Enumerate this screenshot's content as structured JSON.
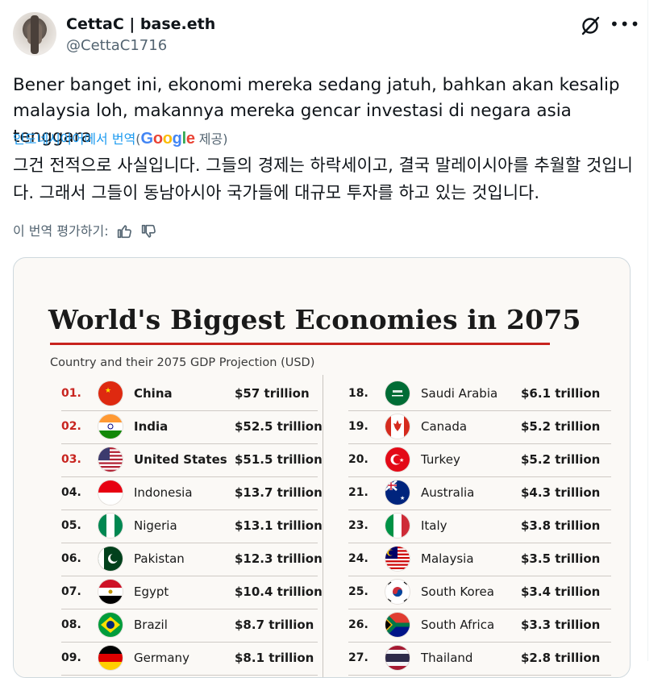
{
  "user": {
    "display_name": "CettaC | base.eth",
    "handle": "@CettaC1716"
  },
  "tweet": {
    "text": "Bener banget ini, ekonomi mereka sedang jatuh, bahkan akan kesalip malaysia loh, makannya mereka gencar investasi di negara asia tenggara",
    "translate_link": "인도네시아어에서 번역",
    "translate_prefix": "(",
    "translate_provider": "Google",
    "translate_suffix": " 제공)",
    "translated_text": "그건 전적으로 사실입니다. 그들의 경제는 하락세이고, 결국 말레이시아를 추월할 것입니다. 그래서 그들이 동남아시아 국가들에 대규모 투자를 하고 있는 것입니다.",
    "rate_label": "이 번역 평가하기:"
  },
  "icons": {
    "grok": "grok-icon",
    "more": "more-icon",
    "thumbs_up": "thumbs-up-icon",
    "thumbs_down": "thumbs-down-icon"
  },
  "colors": {
    "accent_red": "#c8241f",
    "link_blue": "#1d9bf0",
    "muted": "#536471"
  },
  "image": {
    "title": "World's Biggest Economies in 2075",
    "subtitle": "Country and their 2075 GDP Projection (USD)",
    "left_rows": [
      {
        "rank": "01.",
        "country": "China",
        "gdp": "$57 trillion",
        "flag": "china-flag-icon",
        "highlight": true
      },
      {
        "rank": "02.",
        "country": "India",
        "gdp": "$52.5 trillion",
        "flag": "india-flag-icon",
        "highlight": true
      },
      {
        "rank": "03.",
        "country": "United States",
        "gdp": "$51.5 trillion",
        "flag": "usa-flag-icon",
        "highlight": true
      },
      {
        "rank": "04.",
        "country": "Indonesia",
        "gdp": "$13.7 trillion",
        "flag": "indonesia-flag-icon",
        "highlight": false
      },
      {
        "rank": "05.",
        "country": "Nigeria",
        "gdp": "$13.1 trillion",
        "flag": "nigeria-flag-icon",
        "highlight": false
      },
      {
        "rank": "06.",
        "country": "Pakistan",
        "gdp": "$12.3 trillion",
        "flag": "pakistan-flag-icon",
        "highlight": false
      },
      {
        "rank": "07.",
        "country": "Egypt",
        "gdp": "$10.4 trillion",
        "flag": "egypt-flag-icon",
        "highlight": false
      },
      {
        "rank": "08.",
        "country": "Brazil",
        "gdp": "$8.7 trillion",
        "flag": "brazil-flag-icon",
        "highlight": false
      },
      {
        "rank": "09.",
        "country": "Germany",
        "gdp": "$8.1 trillion",
        "flag": "germany-flag-icon",
        "highlight": false
      }
    ],
    "right_rows": [
      {
        "rank": "18.",
        "country": "Saudi Arabia",
        "gdp": "$6.1 trillion",
        "flag": "saudi-arabia-flag-icon",
        "highlight": false
      },
      {
        "rank": "19.",
        "country": "Canada",
        "gdp": "$5.2 trillion",
        "flag": "canada-flag-icon",
        "highlight": false
      },
      {
        "rank": "20.",
        "country": "Turkey",
        "gdp": "$5.2 trillion",
        "flag": "turkey-flag-icon",
        "highlight": false
      },
      {
        "rank": "21.",
        "country": "Australia",
        "gdp": "$4.3 trillion",
        "flag": "australia-flag-icon",
        "highlight": false
      },
      {
        "rank": "23.",
        "country": "Italy",
        "gdp": "$3.8 trillion",
        "flag": "italy-flag-icon",
        "highlight": false
      },
      {
        "rank": "24.",
        "country": "Malaysia",
        "gdp": "$3.5 trillion",
        "flag": "malaysia-flag-icon",
        "highlight": false
      },
      {
        "rank": "25.",
        "country": "South Korea",
        "gdp": "$3.4 trillion",
        "flag": "south-korea-flag-icon",
        "highlight": false
      },
      {
        "rank": "26.",
        "country": "South Africa",
        "gdp": "$3.3 trillion",
        "flag": "south-africa-flag-icon",
        "highlight": false
      },
      {
        "rank": "27.",
        "country": "Thailand",
        "gdp": "$2.8 trillion",
        "flag": "thailand-flag-icon",
        "highlight": false
      }
    ]
  }
}
